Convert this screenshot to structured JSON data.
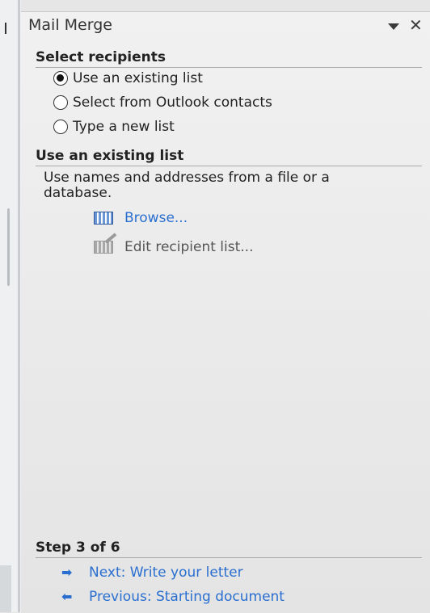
{
  "pane": {
    "title": "Mail Merge",
    "close_glyph": "✕",
    "menu_icon": "dropdown-arrow-icon"
  },
  "select_recipients": {
    "heading": "Select recipients",
    "options": [
      {
        "label": "Use an existing list",
        "checked": true
      },
      {
        "label": "Select from Outlook contacts",
        "checked": false
      },
      {
        "label": "Type a new list",
        "checked": false
      }
    ]
  },
  "existing_list": {
    "heading": "Use an existing list",
    "description": "Use names and addresses from a file or a database.",
    "browse_label": "Browse...",
    "edit_label": "Edit recipient list..."
  },
  "step": {
    "label": "Step 3 of 6",
    "next_label": "Next: Write your letter",
    "previous_label": "Previous: Starting document",
    "next_glyph": "➡",
    "previous_glyph": "⬅"
  },
  "colors": {
    "link": "#2a6fd0",
    "pane_bg": "#ececec"
  }
}
